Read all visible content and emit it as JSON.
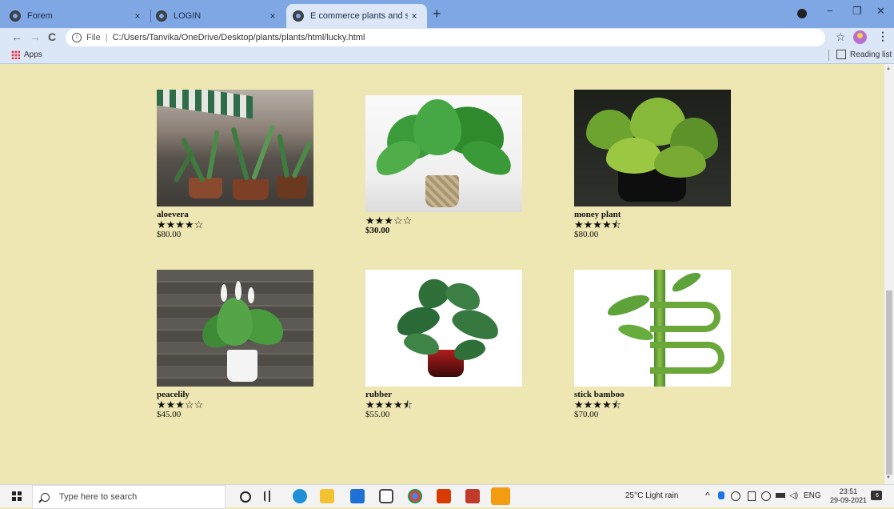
{
  "browser": {
    "tabs": [
      {
        "label": "Forem",
        "close": "×"
      },
      {
        "label": "LOGIN",
        "close": "×"
      },
      {
        "label": "E commerce plants and seeds pl",
        "close": "×"
      }
    ],
    "new_tab": "+",
    "window_controls": {
      "minimize": "−",
      "restore": "❐",
      "close": "✕"
    },
    "nav": {
      "back": "←",
      "forward": "→",
      "reload": "C"
    },
    "address": {
      "info": "i",
      "scheme_label": "File",
      "separator": "|",
      "url": "C:/Users/Tanvika/OneDrive/Desktop/plants/plants/html/lucky.html"
    },
    "bookmark_star": "☆",
    "menu": "⋮",
    "bookmarks": {
      "apps": "Apps",
      "reading_list": "Reading list"
    }
  },
  "products": [
    {
      "name": "aloevera",
      "stars": "★★★★☆",
      "price": "$80.00",
      "price_bold": false
    },
    {
      "name": "",
      "stars": "★★★☆☆",
      "price": "$30.00",
      "price_bold": true
    },
    {
      "name": "money plant",
      "stars": "★★★★⯪",
      "price": "$80.00",
      "price_bold": false
    },
    {
      "name": "peacelily",
      "stars": "★★★☆☆",
      "price": "$45.00",
      "price_bold": false
    },
    {
      "name": "rubber",
      "stars": "★★★★⯪",
      "price": "$55.00",
      "price_bold": false
    },
    {
      "name": "stick bamboo",
      "stars": "★★★★⯪",
      "price": "$70.00",
      "price_bold": false
    }
  ],
  "taskbar": {
    "search_placeholder": "Type here to search",
    "weather": "25°C  Light rain",
    "tray_arrow": "^",
    "language": "ENG",
    "time": "23:51",
    "date": "29-09-2021",
    "notification_count": "6"
  },
  "colors": {
    "page_background": "#eee6b3",
    "tab_strip": "#7fa7e4",
    "toolbar": "#dbe6f7"
  }
}
